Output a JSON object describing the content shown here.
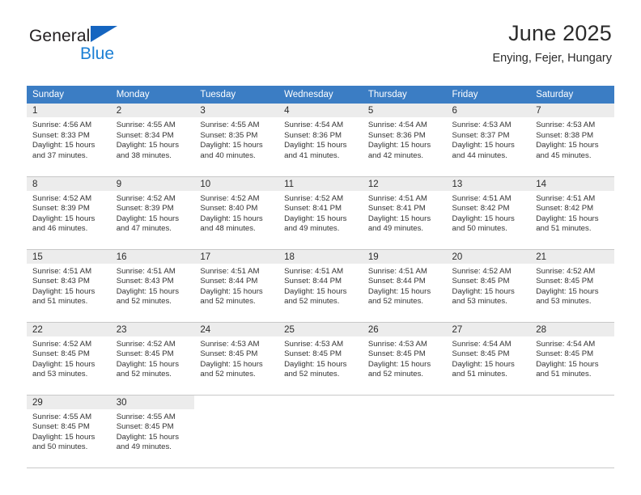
{
  "brand": {
    "name_part1": "General",
    "name_part2": "Blue",
    "triangle_color": "#1565c0",
    "blue_text_color": "#1b7fd4"
  },
  "header": {
    "title": "June 2025",
    "subtitle": "Enying, Fejer, Hungary"
  },
  "theme": {
    "header_row_color": "#3b7dc4",
    "daynumber_band_color": "#ececec",
    "grid_line_color": "#c8c8c8",
    "text_color": "#333333"
  },
  "calendar": {
    "weekday_headers": [
      "Sunday",
      "Monday",
      "Tuesday",
      "Wednesday",
      "Thursday",
      "Friday",
      "Saturday"
    ],
    "weeks": [
      [
        {
          "day": "1",
          "sunrise": "Sunrise: 4:56 AM",
          "sunset": "Sunset: 8:33 PM",
          "daylight_line1": "Daylight: 15 hours",
          "daylight_line2": "and 37 minutes."
        },
        {
          "day": "2",
          "sunrise": "Sunrise: 4:55 AM",
          "sunset": "Sunset: 8:34 PM",
          "daylight_line1": "Daylight: 15 hours",
          "daylight_line2": "and 38 minutes."
        },
        {
          "day": "3",
          "sunrise": "Sunrise: 4:55 AM",
          "sunset": "Sunset: 8:35 PM",
          "daylight_line1": "Daylight: 15 hours",
          "daylight_line2": "and 40 minutes."
        },
        {
          "day": "4",
          "sunrise": "Sunrise: 4:54 AM",
          "sunset": "Sunset: 8:36 PM",
          "daylight_line1": "Daylight: 15 hours",
          "daylight_line2": "and 41 minutes."
        },
        {
          "day": "5",
          "sunrise": "Sunrise: 4:54 AM",
          "sunset": "Sunset: 8:36 PM",
          "daylight_line1": "Daylight: 15 hours",
          "daylight_line2": "and 42 minutes."
        },
        {
          "day": "6",
          "sunrise": "Sunrise: 4:53 AM",
          "sunset": "Sunset: 8:37 PM",
          "daylight_line1": "Daylight: 15 hours",
          "daylight_line2": "and 44 minutes."
        },
        {
          "day": "7",
          "sunrise": "Sunrise: 4:53 AM",
          "sunset": "Sunset: 8:38 PM",
          "daylight_line1": "Daylight: 15 hours",
          "daylight_line2": "and 45 minutes."
        }
      ],
      [
        {
          "day": "8",
          "sunrise": "Sunrise: 4:52 AM",
          "sunset": "Sunset: 8:39 PM",
          "daylight_line1": "Daylight: 15 hours",
          "daylight_line2": "and 46 minutes."
        },
        {
          "day": "9",
          "sunrise": "Sunrise: 4:52 AM",
          "sunset": "Sunset: 8:39 PM",
          "daylight_line1": "Daylight: 15 hours",
          "daylight_line2": "and 47 minutes."
        },
        {
          "day": "10",
          "sunrise": "Sunrise: 4:52 AM",
          "sunset": "Sunset: 8:40 PM",
          "daylight_line1": "Daylight: 15 hours",
          "daylight_line2": "and 48 minutes."
        },
        {
          "day": "11",
          "sunrise": "Sunrise: 4:52 AM",
          "sunset": "Sunset: 8:41 PM",
          "daylight_line1": "Daylight: 15 hours",
          "daylight_line2": "and 49 minutes."
        },
        {
          "day": "12",
          "sunrise": "Sunrise: 4:51 AM",
          "sunset": "Sunset: 8:41 PM",
          "daylight_line1": "Daylight: 15 hours",
          "daylight_line2": "and 49 minutes."
        },
        {
          "day": "13",
          "sunrise": "Sunrise: 4:51 AM",
          "sunset": "Sunset: 8:42 PM",
          "daylight_line1": "Daylight: 15 hours",
          "daylight_line2": "and 50 minutes."
        },
        {
          "day": "14",
          "sunrise": "Sunrise: 4:51 AM",
          "sunset": "Sunset: 8:42 PM",
          "daylight_line1": "Daylight: 15 hours",
          "daylight_line2": "and 51 minutes."
        }
      ],
      [
        {
          "day": "15",
          "sunrise": "Sunrise: 4:51 AM",
          "sunset": "Sunset: 8:43 PM",
          "daylight_line1": "Daylight: 15 hours",
          "daylight_line2": "and 51 minutes."
        },
        {
          "day": "16",
          "sunrise": "Sunrise: 4:51 AM",
          "sunset": "Sunset: 8:43 PM",
          "daylight_line1": "Daylight: 15 hours",
          "daylight_line2": "and 52 minutes."
        },
        {
          "day": "17",
          "sunrise": "Sunrise: 4:51 AM",
          "sunset": "Sunset: 8:44 PM",
          "daylight_line1": "Daylight: 15 hours",
          "daylight_line2": "and 52 minutes."
        },
        {
          "day": "18",
          "sunrise": "Sunrise: 4:51 AM",
          "sunset": "Sunset: 8:44 PM",
          "daylight_line1": "Daylight: 15 hours",
          "daylight_line2": "and 52 minutes."
        },
        {
          "day": "19",
          "sunrise": "Sunrise: 4:51 AM",
          "sunset": "Sunset: 8:44 PM",
          "daylight_line1": "Daylight: 15 hours",
          "daylight_line2": "and 52 minutes."
        },
        {
          "day": "20",
          "sunrise": "Sunrise: 4:52 AM",
          "sunset": "Sunset: 8:45 PM",
          "daylight_line1": "Daylight: 15 hours",
          "daylight_line2": "and 53 minutes."
        },
        {
          "day": "21",
          "sunrise": "Sunrise: 4:52 AM",
          "sunset": "Sunset: 8:45 PM",
          "daylight_line1": "Daylight: 15 hours",
          "daylight_line2": "and 53 minutes."
        }
      ],
      [
        {
          "day": "22",
          "sunrise": "Sunrise: 4:52 AM",
          "sunset": "Sunset: 8:45 PM",
          "daylight_line1": "Daylight: 15 hours",
          "daylight_line2": "and 53 minutes."
        },
        {
          "day": "23",
          "sunrise": "Sunrise: 4:52 AM",
          "sunset": "Sunset: 8:45 PM",
          "daylight_line1": "Daylight: 15 hours",
          "daylight_line2": "and 52 minutes."
        },
        {
          "day": "24",
          "sunrise": "Sunrise: 4:53 AM",
          "sunset": "Sunset: 8:45 PM",
          "daylight_line1": "Daylight: 15 hours",
          "daylight_line2": "and 52 minutes."
        },
        {
          "day": "25",
          "sunrise": "Sunrise: 4:53 AM",
          "sunset": "Sunset: 8:45 PM",
          "daylight_line1": "Daylight: 15 hours",
          "daylight_line2": "and 52 minutes."
        },
        {
          "day": "26",
          "sunrise": "Sunrise: 4:53 AM",
          "sunset": "Sunset: 8:45 PM",
          "daylight_line1": "Daylight: 15 hours",
          "daylight_line2": "and 52 minutes."
        },
        {
          "day": "27",
          "sunrise": "Sunrise: 4:54 AM",
          "sunset": "Sunset: 8:45 PM",
          "daylight_line1": "Daylight: 15 hours",
          "daylight_line2": "and 51 minutes."
        },
        {
          "day": "28",
          "sunrise": "Sunrise: 4:54 AM",
          "sunset": "Sunset: 8:45 PM",
          "daylight_line1": "Daylight: 15 hours",
          "daylight_line2": "and 51 minutes."
        }
      ],
      [
        {
          "day": "29",
          "sunrise": "Sunrise: 4:55 AM",
          "sunset": "Sunset: 8:45 PM",
          "daylight_line1": "Daylight: 15 hours",
          "daylight_line2": "and 50 minutes."
        },
        {
          "day": "30",
          "sunrise": "Sunrise: 4:55 AM",
          "sunset": "Sunset: 8:45 PM",
          "daylight_line1": "Daylight: 15 hours",
          "daylight_line2": "and 49 minutes."
        },
        null,
        null,
        null,
        null,
        null
      ]
    ]
  }
}
